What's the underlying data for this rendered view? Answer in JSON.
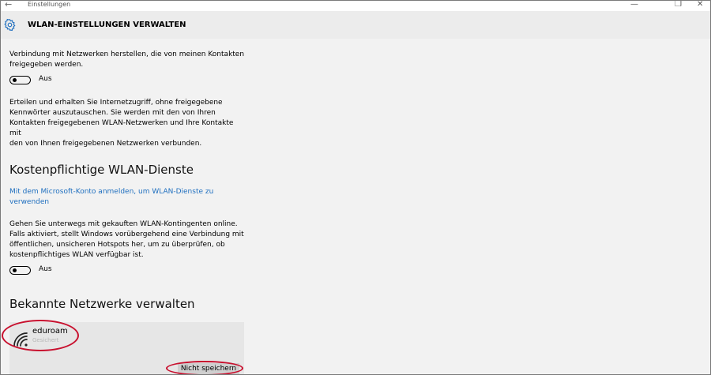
{
  "window": {
    "app_title": "Einstellungen",
    "back_glyph": "←",
    "minimize_glyph": "—",
    "restore_glyph": "❐",
    "close_glyph": "✕"
  },
  "header": {
    "title": "WLAN-EINSTELLUNGEN VERWALTEN",
    "icon": "gear-icon"
  },
  "contacts_section": {
    "description": "Verbindung mit Netzwerken herstellen, die von meinen Kontakten\nfreigegeben werden.",
    "toggle_state": "Aus",
    "info": "Erteilen und erhalten Sie Internetzugriff, ohne freigegebene\nKennwörter auszutauschen. Sie werden mit den von Ihren\nKontakten freigegebenen WLAN-Netzwerken und Ihre Kontakte mit\nden von Ihnen freigegebenen Netzwerken verbunden."
  },
  "paid_section": {
    "heading": "Kostenpflichtige WLAN-Dienste",
    "link": "Mit dem Microsoft-Konto anmelden, um WLAN-Dienste zu\nverwenden",
    "description": "Gehen Sie unterwegs mit gekauften WLAN-Kontingenten online.\nFalls aktiviert, stellt Windows vorübergehend eine Verbindung mit\nöffentlichen, unsicheren Hotspots her, um zu überprüfen, ob\nkostenpflichtiges WLAN verfügbar ist.",
    "toggle_state": "Aus"
  },
  "known_networks": {
    "heading": "Bekannte Netzwerke verwalten",
    "networks": [
      {
        "name": "eduroam",
        "sub": "Gesichert",
        "icon": "wifi-icon",
        "forget_label": "Nicht speichern"
      }
    ]
  },
  "colors": {
    "accent_link": "#1f6fbf",
    "annotation": "#c8102e",
    "header_bg": "#ececec",
    "content_bg": "#f2f2f2"
  }
}
